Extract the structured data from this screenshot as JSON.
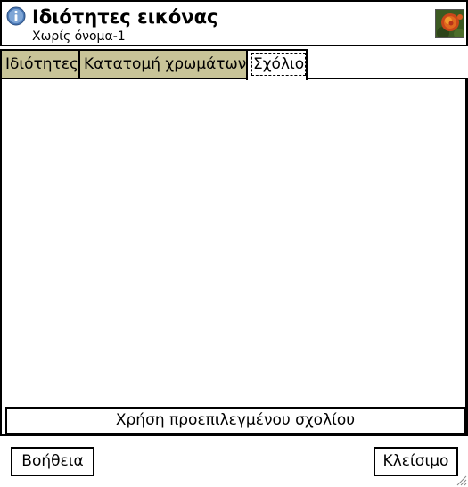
{
  "window": {
    "title": "Ιδιότητες εικόνας",
    "subtitle": "Χωρίς όνομα-1",
    "icon": "info-icon",
    "thumbnail": "image-thumbnail"
  },
  "tabs": [
    {
      "label": "Ιδιότητες",
      "active": false
    },
    {
      "label": "Κατατομή χρωμάτων",
      "active": false
    },
    {
      "label": "Σχόλιο",
      "active": true
    }
  ],
  "comment": {
    "value": "",
    "default_button_label": "Χρήση προεπιλεγμένου σχολίου"
  },
  "footer": {
    "help_label": "Βοήθεια",
    "close_label": "Κλείσιμο"
  },
  "colors": {
    "inactive_tab_bg": "#c8c498",
    "border": "#000000",
    "info_icon": "#4a78b5"
  }
}
